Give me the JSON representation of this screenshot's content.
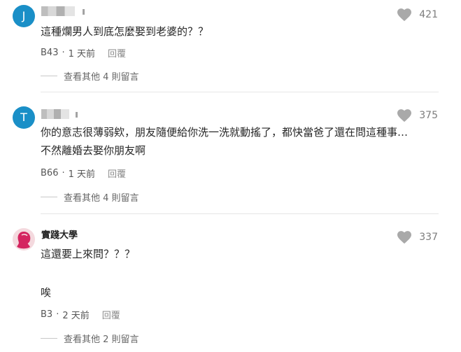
{
  "comments": [
    {
      "avatar_letter": "J",
      "author": "",
      "likes": "421",
      "lines": [
        "這種爛男人到底怎麼娶到老婆的？？"
      ],
      "floor": "B43",
      "time": "1 天前",
      "reply_label": "回覆",
      "more_replies": "查看其他 4 則留言"
    },
    {
      "avatar_letter": "T",
      "author": "",
      "likes": "375",
      "lines": [
        "你的意志很薄弱欸，朋友隨便給你洗一洗就動搖了，都快當爸了還在問這種事…",
        "不然離婚去娶你朋友啊"
      ],
      "floor": "B66",
      "time": "1 天前",
      "reply_label": "回覆",
      "more_replies": "查看其他 4 則留言"
    },
    {
      "avatar_letter": "",
      "author": "實踐大學",
      "likes": "337",
      "lines": [
        "這還要上來問？？？",
        "",
        "唉"
      ],
      "floor": "B3",
      "time": "2 天前",
      "reply_label": "回覆",
      "more_replies": "查看其他 2 則留言"
    }
  ],
  "meta_separator": "·",
  "colors": {
    "avatar_blue": "#1a8fc7",
    "avatar_pink": "#f4d9de",
    "heart": "#a9a9a9"
  },
  "icons": {
    "like": "heart-icon",
    "avatar_pink": "person-silhouette-icon"
  }
}
